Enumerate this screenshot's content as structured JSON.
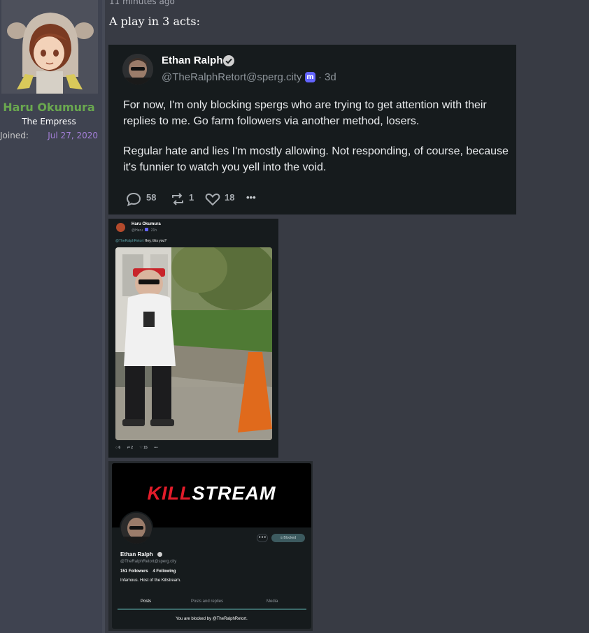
{
  "user": {
    "name": "Haru Okumura",
    "title": "The Empress",
    "joined_label": "Joined:",
    "joined_date": "Jul 27, 2020"
  },
  "post": {
    "timestamp": "11 minutes ago",
    "text": "A play in 3 acts:"
  },
  "embed_main": {
    "author_name": "Ethan Ralph",
    "author_handle": "@TheRalphRetort@sperg.city",
    "separator": "·",
    "age": "3d",
    "paragraphs": [
      "For now, I'm only blocking spergs who are trying to get attention with their replies to me. Go farm followers via another method, losers.",
      "Regular hate and lies I'm mostly allowing. Not responding, of course, because it's funnier to watch you yell into the void."
    ],
    "reply_count": "58",
    "boost_count": "1",
    "like_count": "18",
    "more_label": "•••"
  },
  "embed_reply": {
    "author_name": "Haru Okumura",
    "author_handle": "@Haru",
    "age": "21h",
    "mention": "@TheRalphRetort",
    "text": "Hey, this you?",
    "reply_count": "6",
    "boost_count": "2",
    "like_count": "15",
    "more_label": "•••"
  },
  "embed_profile": {
    "banner_logo_red": "KILL",
    "banner_logo_white": "STREAM",
    "more_label": "•••",
    "blocked_label": "Blocked",
    "name": "Ethan Ralph",
    "handle": "@TheRalphRetort@sperg.city",
    "followers_count": "151",
    "followers_label": "Followers",
    "following_count": "4",
    "following_label": "Following",
    "bio": "Infamous. Host of the Killstream.",
    "tabs": [
      "Posts",
      "Posts and replies",
      "Media"
    ],
    "footer": "You are blocked by @TheRalphRetort."
  },
  "colors": {
    "page_bg": "#383b44",
    "username": "#6aa84f",
    "joined_date": "#a47fd9",
    "card_bg": "#161b1d",
    "mastodon": "#6364ff",
    "killstream_red": "#e21c2a"
  }
}
